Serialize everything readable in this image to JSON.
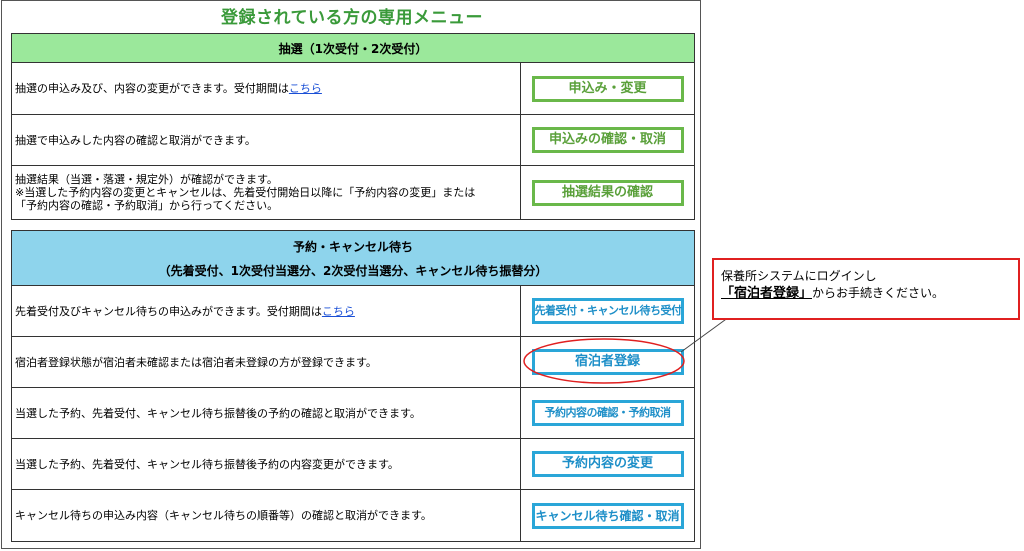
{
  "menu": {
    "title": "登録されている方の専用メニュー"
  },
  "lottery": {
    "header": "抽選（1次受付・2次受付）",
    "rows": [
      {
        "text": "抽選の申込み及び、内容の変更ができます。受付期間は",
        "link": "こちら",
        "button": "申込み・変更"
      },
      {
        "text": "抽選で申込みした内容の確認と取消ができます。",
        "button": "申込みの確認・取消"
      },
      {
        "text_lines": [
          "抽選結果（当選・落選・規定外）が確認ができます。",
          "※当選した予約内容の変更とキャンセルは、先着受付開始日以降に「予約内容の変更」または",
          "「予約内容の確認・予約取消」から行ってください。"
        ],
        "button": "抽選結果の確認"
      }
    ]
  },
  "reservation": {
    "header_line1": "予約・キャンセル待ち",
    "header_line2": "（先着受付、1次受付当選分、2次受付当選分、キャンセル待ち振替分）",
    "rows": [
      {
        "text": "先着受付及びキャンセル待ちの申込みができます。受付期間は",
        "link": "こちら",
        "button": "先着受付・キャンセル待ち受付"
      },
      {
        "text": "宿泊者登録状態が宿泊者未確認または宿泊者未登録の方が登録できます。",
        "button": "宿泊者登録"
      },
      {
        "text": "当選した予約、先着受付、キャンセル待ち振替後の予約の確認と取消ができます。",
        "button": "予約内容の確認・予約取消"
      },
      {
        "text": "当選した予約、先着受付、キャンセル待ち振替後予約の内容変更ができます。",
        "button": "予約内容の変更"
      },
      {
        "text": "キャンセル待ちの申込み内容（キャンセル待ちの順番等）の確認と取消ができます。",
        "button": "キャンセル待ち確認・取消"
      }
    ]
  },
  "callout": {
    "line1": "保養所システムにログインし",
    "highlight": "「宿泊者登録」",
    "line2_suffix": "からお手続きください。"
  },
  "colors": {
    "green_header": "#9be89b",
    "blue_header": "#8ed4ec",
    "green_button": "#6ab84a",
    "blue_button": "#2aa6d8",
    "callout_border": "#e02020",
    "link": "#1a4fd6"
  }
}
